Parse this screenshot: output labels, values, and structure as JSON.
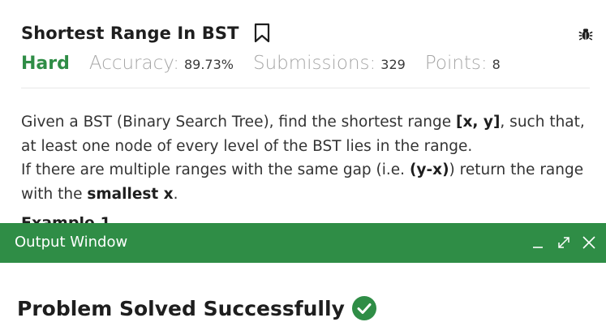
{
  "problem": {
    "title": "Shortest Range In BST",
    "difficulty": "Hard",
    "accuracy_label": "Accuracy:",
    "accuracy_value": "89.73%",
    "submissions_label": "Submissions:",
    "submissions_value": "329",
    "points_label": "Points:",
    "points_value": "8",
    "description": {
      "p1_a": "Given a BST (Binary Search Tree), find the shortest range ",
      "p1_b": "[x, y]",
      "p1_c": ", such that, at least one node of every level of the BST lies in the range.",
      "p2_a": "If there are multiple ranges with the same gap (i.e. ",
      "p2_b": "(y-x)",
      "p2_c": ") return the range with the ",
      "p2_d": "smallest x",
      "p2_e": "."
    },
    "example_heading": "Example 1"
  },
  "output_window": {
    "title": "Output Window",
    "result_text": "Problem Solved Successfully"
  },
  "colors": {
    "brand_green": "#2f8d46",
    "success_check": "#2f8d46"
  },
  "icons": [
    "bookmark-icon",
    "bug-icon",
    "minimize-icon",
    "expand-icon",
    "close-icon",
    "check-circle-icon"
  ]
}
